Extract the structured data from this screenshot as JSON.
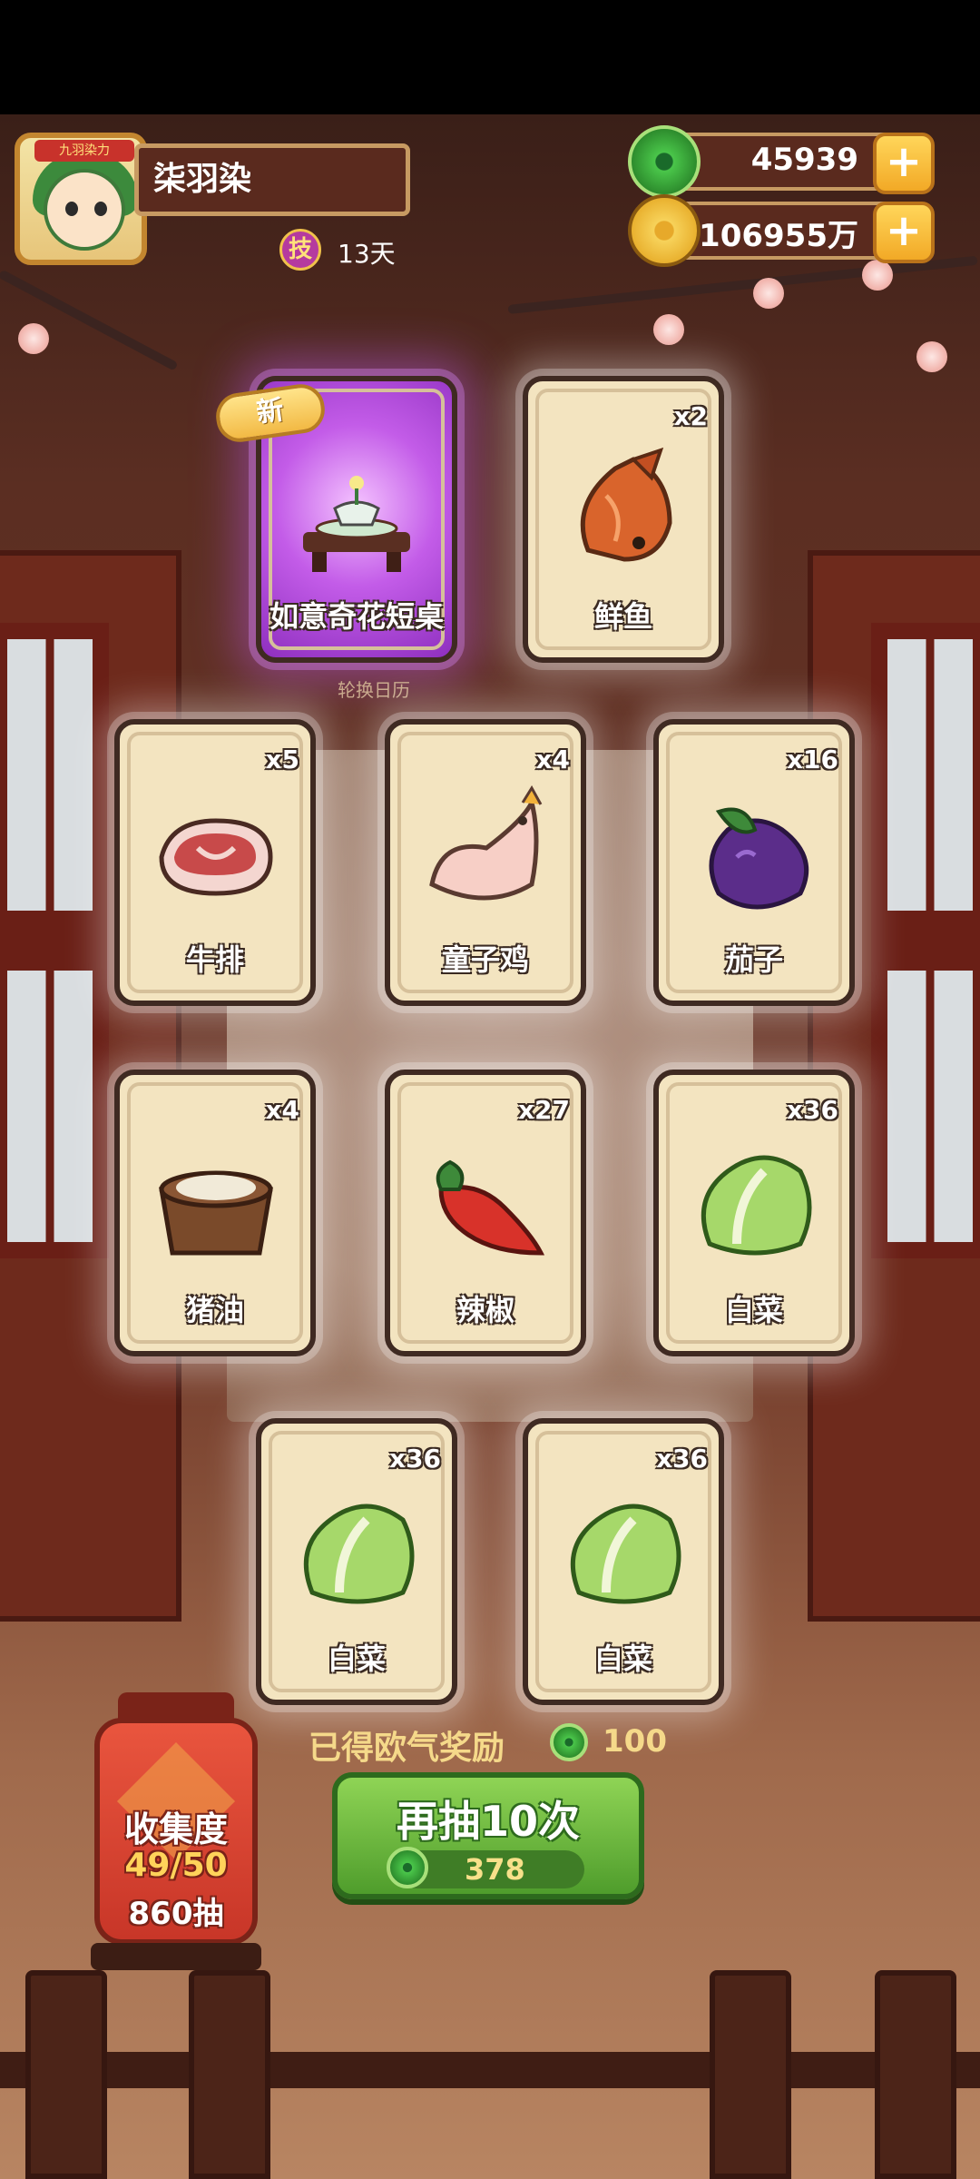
{
  "player": {
    "name": "柒羽染",
    "skill_icon_text": "技",
    "skill_days": "13天",
    "avatar_banner": "九羽染力"
  },
  "currencies": [
    {
      "name": "jade",
      "value": "45939"
    },
    {
      "name": "coin",
      "value": "106955万"
    }
  ],
  "new_badge": "新",
  "calendar_label": "轮换日历",
  "cards": [
    {
      "name": "如意奇花短桌",
      "qty": "",
      "art": "table-icon",
      "rarity": "purple"
    },
    {
      "name": "鲜鱼",
      "qty": "x2",
      "art": "fish-icon",
      "rarity": "normal"
    },
    {
      "name": "牛排",
      "qty": "x5",
      "art": "steak-icon",
      "rarity": "normal"
    },
    {
      "name": "童子鸡",
      "qty": "x4",
      "art": "chicken-icon",
      "rarity": "normal"
    },
    {
      "name": "茄子",
      "qty": "x16",
      "art": "eggplant-icon",
      "rarity": "normal"
    },
    {
      "name": "猪油",
      "qty": "x4",
      "art": "lard-icon",
      "rarity": "normal"
    },
    {
      "name": "辣椒",
      "qty": "x27",
      "art": "pepper-icon",
      "rarity": "normal"
    },
    {
      "name": "白菜",
      "qty": "x36",
      "art": "cabbage-icon",
      "rarity": "normal"
    },
    {
      "name": "白菜",
      "qty": "x36",
      "art": "cabbage-icon",
      "rarity": "normal"
    },
    {
      "name": "白菜",
      "qty": "x36",
      "art": "cabbage-icon",
      "rarity": "normal"
    }
  ],
  "reward": {
    "label": "已得欧气奖励",
    "value": "100"
  },
  "draw_button": {
    "label": "再抽10次",
    "cost": "378"
  },
  "collection": {
    "title": "收集度",
    "progress": "49/50",
    "draws": "860抽"
  },
  "colors": {
    "accent_green": "#4f9d2c",
    "gold": "#f5d98a",
    "card_bg": "#f3e4c0",
    "purple_glow": "#c35ce8"
  }
}
